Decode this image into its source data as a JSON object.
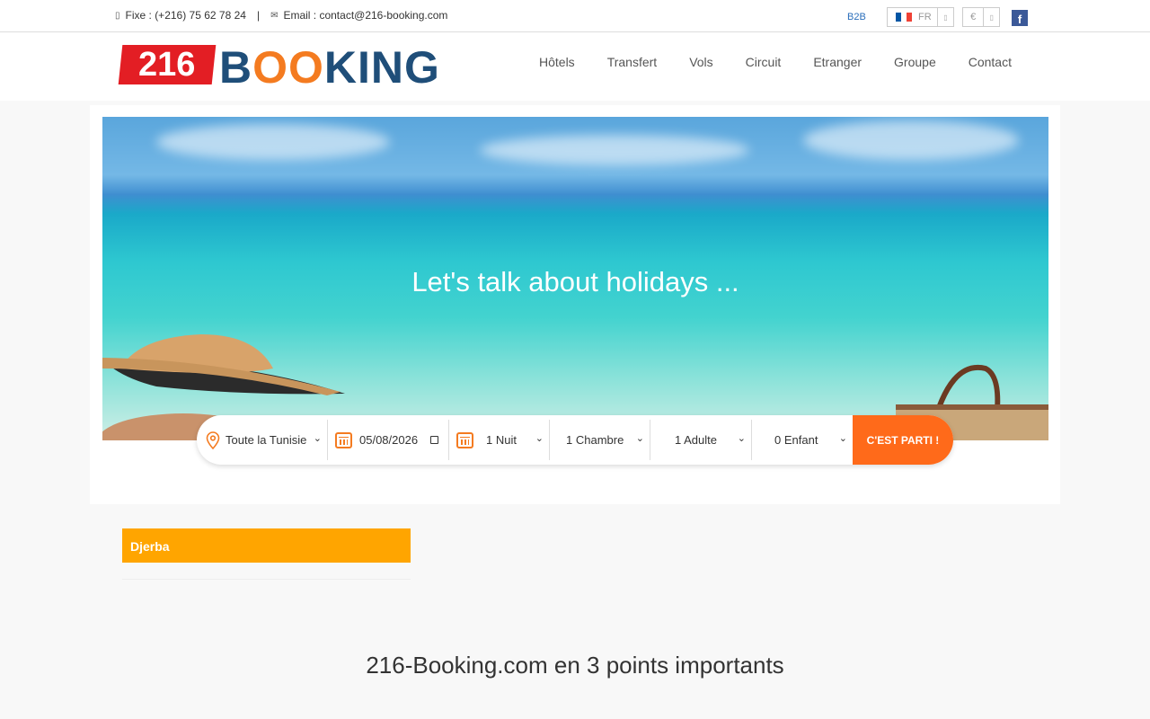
{
  "topbar": {
    "phone_icon": "mobile-icon",
    "phone_text": "Fixe : (+216) 75 62 78 24",
    "separator": "|",
    "email_icon": "envelope-icon",
    "email_text": "Email : contact@216-booking.com",
    "b2b": "B2B",
    "lang": "FR",
    "currency": "€",
    "facebook": "f"
  },
  "logo": {
    "number": "216",
    "word_b": "B",
    "word_o1": "O",
    "word_o2": "O",
    "word_rest": "KING"
  },
  "nav": [
    "Hôtels",
    "Transfert",
    "Vols",
    "Circuit",
    "Etranger",
    "Groupe",
    "Contact"
  ],
  "hero": {
    "title": "Let's talk about holidays ..."
  },
  "search": {
    "destination": "Toute la Tunisie",
    "date": "05/08/2026",
    "nights": "1 Nuit",
    "rooms": "1 Chambre",
    "adults": "1 Adulte",
    "children": "0 Enfant",
    "submit": "C'EST PARTI !"
  },
  "destination_tab": "Djerba",
  "section_title": "216-Booking.com en 3 points importants",
  "colors": {
    "brand_red": "#e31e24",
    "brand_blue": "#1f4e79",
    "accent_orange": "#f47b20",
    "button_orange": "#ff6a1a",
    "tab_orange": "#ffa500"
  }
}
